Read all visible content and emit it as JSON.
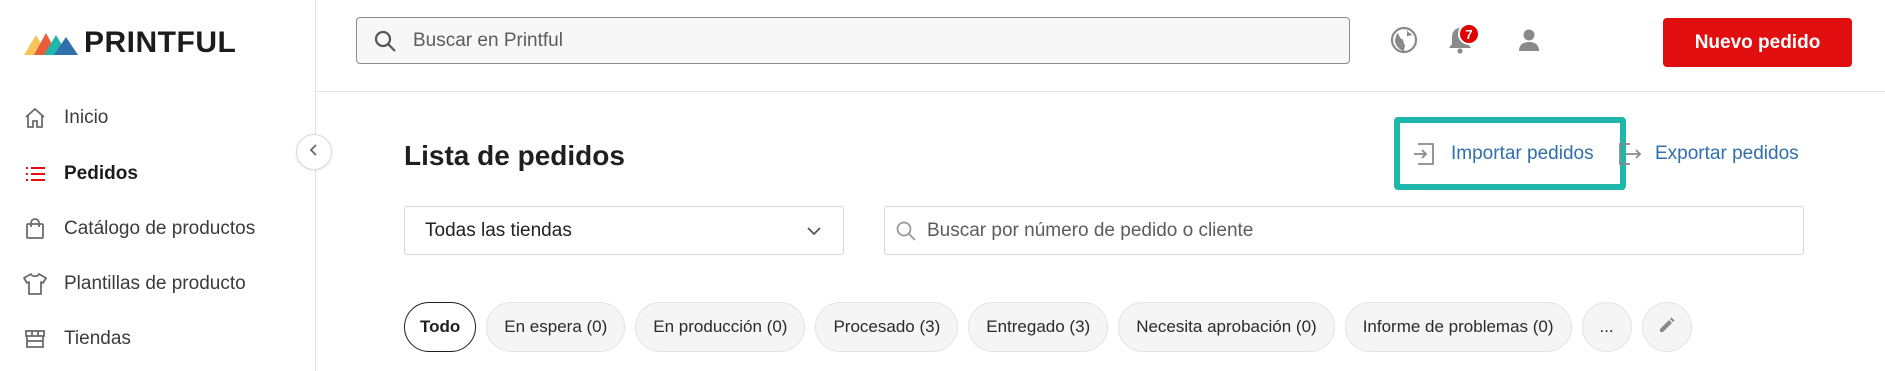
{
  "brand": {
    "name": "PRINTFUL",
    "colors": [
      "#f7c35b",
      "#e85d3a",
      "#1fb7ab",
      "#2f6fab"
    ]
  },
  "sidebar": {
    "items": [
      {
        "label": "Inicio",
        "icon": "home-icon",
        "active": false
      },
      {
        "label": "Pedidos",
        "icon": "list-icon",
        "active": true
      },
      {
        "label": "Catálogo de productos",
        "icon": "shopping-bag-icon",
        "active": false
      },
      {
        "label": "Plantillas de producto",
        "icon": "tshirt-icon",
        "active": false
      },
      {
        "label": "Tiendas",
        "icon": "store-icon",
        "active": false
      }
    ],
    "collapse_icon": "chevron-left-icon"
  },
  "header": {
    "search_placeholder": "Buscar en Printful",
    "notifications_count": "7",
    "new_order_label": "Nuevo pedido",
    "icons": [
      "globe-icon",
      "bell-icon",
      "user-icon"
    ]
  },
  "main": {
    "title": "Lista de pedidos",
    "import_label": "Importar pedidos",
    "export_label": "Exportar pedidos",
    "store_filter": {
      "selected": "Todas las tiendas"
    },
    "order_search_placeholder": "Buscar por número de pedido o cliente",
    "tabs": [
      {
        "label": "Todo",
        "active": true
      },
      {
        "label": "En espera (0)",
        "active": false
      },
      {
        "label": "En producción (0)",
        "active": false
      },
      {
        "label": "Procesado (3)",
        "active": false
      },
      {
        "label": "Entregado (3)",
        "active": false
      },
      {
        "label": "Necesita aprobación (0)",
        "active": false
      },
      {
        "label": "Informe de problemas (0)",
        "active": false
      }
    ],
    "more_label": "...",
    "highlight_color": "#1fb7ab",
    "accent_red": "#e10f0f",
    "link_blue": "#2f6fab"
  }
}
